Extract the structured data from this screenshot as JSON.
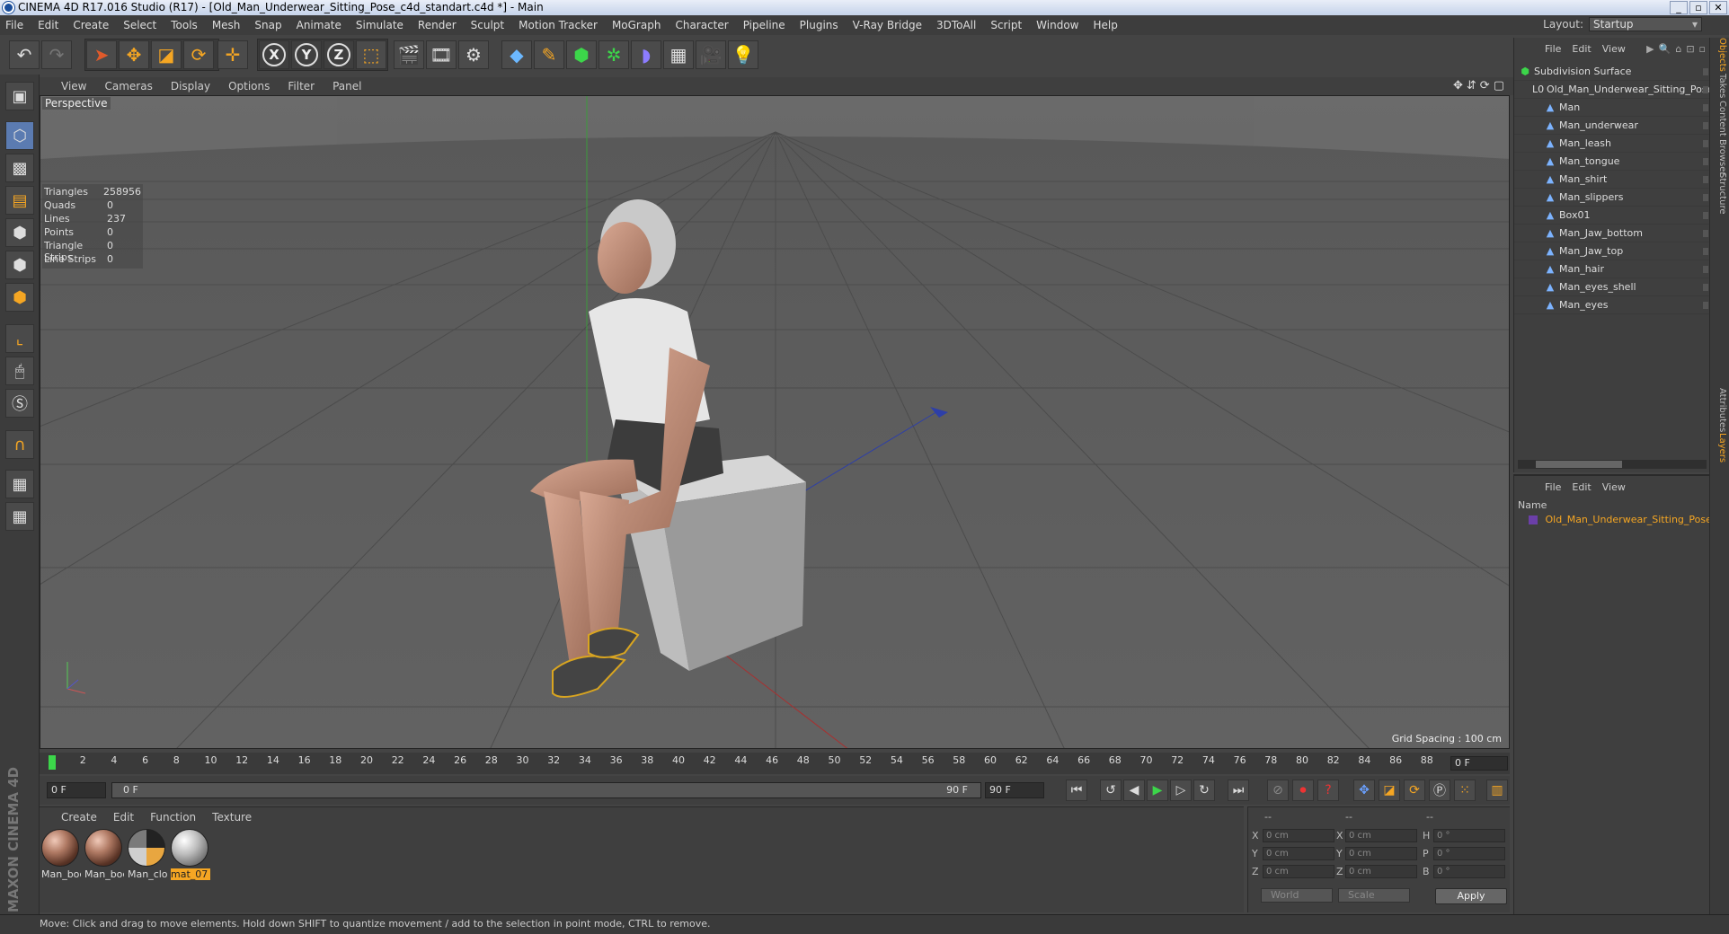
{
  "window": {
    "title": "CINEMA 4D R17.016 Studio (R17) - [Old_Man_Underwear_Sitting_Pose_c4d_standart.c4d *] - Main"
  },
  "menu": [
    "File",
    "Edit",
    "Create",
    "Select",
    "Tools",
    "Mesh",
    "Snap",
    "Animate",
    "Simulate",
    "Render",
    "Sculpt",
    "Motion Tracker",
    "MoGraph",
    "Character",
    "Pipeline",
    "Plugins",
    "V-Ray Bridge",
    "3DToAll",
    "Script",
    "Window",
    "Help"
  ],
  "layout": {
    "label": "Layout:",
    "value": "Startup"
  },
  "toolbar": {
    "axis_x": "X",
    "axis_y": "Y",
    "axis_z": "Z"
  },
  "viewport": {
    "menu": [
      "View",
      "Cameras",
      "Display",
      "Options",
      "Filter",
      "Panel"
    ],
    "camera_label": "Perspective",
    "stats": [
      {
        "k": "Triangles",
        "v": "258956"
      },
      {
        "k": "Quads",
        "v": "0"
      },
      {
        "k": "Lines",
        "v": "237"
      },
      {
        "k": "Points",
        "v": "0"
      },
      {
        "k": "Triangle Strips",
        "v": "0"
      },
      {
        "k": "Line Strips",
        "v": "0"
      }
    ],
    "grid_spacing": "Grid Spacing : 100 cm"
  },
  "timeline": {
    "ticks": [
      "0",
      "2",
      "4",
      "6",
      "8",
      "10",
      "12",
      "14",
      "16",
      "18",
      "20",
      "22",
      "24",
      "26",
      "28",
      "30",
      "32",
      "34",
      "36",
      "38",
      "40",
      "42",
      "44",
      "46",
      "48",
      "50",
      "52",
      "54",
      "56",
      "58",
      "60",
      "62",
      "64",
      "66",
      "68",
      "70",
      "72",
      "74",
      "76",
      "78",
      "80",
      "82",
      "84",
      "86",
      "88",
      "90"
    ],
    "current_frame": "0 F"
  },
  "transport": {
    "start_field": "0 F",
    "range_start": "0 F",
    "range_end": "90 F",
    "end_field": "90 F"
  },
  "materials": {
    "menu": [
      "Create",
      "Edit",
      "Function",
      "Texture"
    ],
    "items": [
      {
        "label": "Man_boc",
        "kind": "skin"
      },
      {
        "label": "Man_boc",
        "kind": "skin"
      },
      {
        "label": "Man_clot",
        "kind": "mixed"
      },
      {
        "label": "mat_07",
        "kind": "grey",
        "selected": true
      }
    ]
  },
  "coordinates": {
    "header": [
      "--",
      "--",
      "--"
    ],
    "rows": [
      {
        "a": "X",
        "av": "0 cm",
        "b": "X",
        "bv": "0 cm",
        "c": "H",
        "cv": "0 °"
      },
      {
        "a": "Y",
        "av": "0 cm",
        "b": "Y",
        "bv": "0 cm",
        "c": "P",
        "cv": "0 °"
      },
      {
        "a": "Z",
        "av": "0 cm",
        "b": "Z",
        "bv": "0 cm",
        "c": "B",
        "cv": "0 °"
      }
    ],
    "mode1": "World",
    "mode2": "Scale",
    "apply": "Apply"
  },
  "status": "Move: Click and drag to move elements. Hold down SHIFT to quantize movement / add to the selection in point mode, CTRL to remove.",
  "objects": {
    "menu": [
      "File",
      "Edit",
      "View"
    ],
    "tree": [
      {
        "name": "Subdivision Surface",
        "level": 0,
        "kind": "root"
      },
      {
        "name": "Old_Man_Underwear_Sitting_Pose",
        "level": 1,
        "kind": "null"
      },
      {
        "name": "Man",
        "level": 2,
        "kind": "child"
      },
      {
        "name": "Man_underwear",
        "level": 2,
        "kind": "child"
      },
      {
        "name": "Man_leash",
        "level": 2,
        "kind": "child"
      },
      {
        "name": "Man_tongue",
        "level": 2,
        "kind": "child"
      },
      {
        "name": "Man_shirt",
        "level": 2,
        "kind": "child"
      },
      {
        "name": "Man_slippers",
        "level": 2,
        "kind": "child"
      },
      {
        "name": "Box01",
        "level": 2,
        "kind": "child"
      },
      {
        "name": "Man_Jaw_bottom",
        "level": 2,
        "kind": "child"
      },
      {
        "name": "Man_Jaw_top",
        "level": 2,
        "kind": "child"
      },
      {
        "name": "Man_hair",
        "level": 2,
        "kind": "child"
      },
      {
        "name": "Man_eyes_shell",
        "level": 2,
        "kind": "child"
      },
      {
        "name": "Man_eyes",
        "level": 2,
        "kind": "child"
      }
    ]
  },
  "layers": {
    "menu": [
      "File",
      "Edit",
      "View"
    ],
    "header": "Name",
    "item": "Old_Man_Underwear_Sitting_Pose"
  },
  "side_tabs": [
    "Objects",
    "Takes",
    "Content Browser",
    "Structure",
    "Attributes",
    "Layers"
  ],
  "brand": "MAXON CINEMA 4D"
}
